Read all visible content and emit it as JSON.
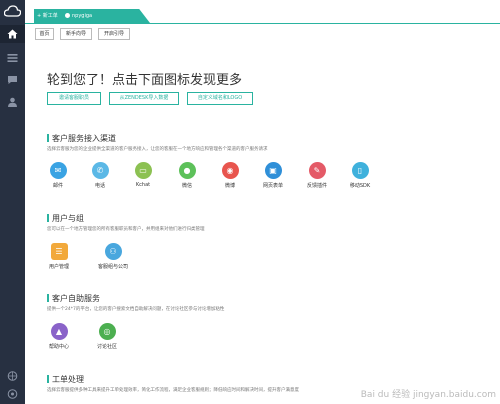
{
  "sidebar": {
    "icons": [
      "cloud-logo-icon",
      "home-icon",
      "list-icon",
      "chat-icon",
      "user-icon",
      "globe-icon",
      "help-icon"
    ]
  },
  "header": {
    "tabs": [
      {
        "label": "+ 新工单"
      },
      {
        "label": "npygiga"
      }
    ]
  },
  "breadcrumbs": [
    {
      "label": "首页"
    },
    {
      "label": "新手向导"
    },
    {
      "label": "开启引导"
    }
  ],
  "main": {
    "title": "轮到您了！点击下面图标发现更多",
    "actions": [
      {
        "label": "邀请客服职员"
      },
      {
        "label": "从ZENDESK导入数据"
      },
      {
        "label": "自定义域名和LOGO"
      }
    ]
  },
  "sections": [
    {
      "title": "客户服务接入渠道",
      "desc": "选择云客服为您的企业提供全渠道的客户服务接入，让您的客服在一个地方响应和管理各个渠道的客户服务请求",
      "items": [
        {
          "label": "邮件",
          "icon": "mail-icon",
          "color": "#3aa3e3",
          "glyph": "✉"
        },
        {
          "label": "电话",
          "icon": "phone-icon",
          "color": "#5bb8e6",
          "glyph": "✆"
        },
        {
          "label": "Kchat",
          "icon": "chat-bubble-icon",
          "color": "#8cc152",
          "glyph": "▭"
        },
        {
          "label": "微信",
          "icon": "wechat-icon",
          "color": "#5dc15a",
          "glyph": "●"
        },
        {
          "label": "微博",
          "icon": "weibo-icon",
          "color": "#e8554e",
          "glyph": "◉"
        },
        {
          "label": "网页表单",
          "icon": "monitor-icon",
          "color": "#2f8fd8",
          "glyph": "▣"
        },
        {
          "label": "反馈插件",
          "icon": "feedback-icon",
          "color": "#e45a67",
          "glyph": "✎"
        },
        {
          "label": "移动SDK",
          "icon": "mobile-icon",
          "color": "#3fb1dc",
          "glyph": "▯"
        }
      ]
    },
    {
      "title": "用户与组",
      "desc": "您可以在一个地方管理您的所有客服职员和客户，并用组来对他们进行归类管理",
      "items": [
        {
          "label": "用户管理",
          "icon": "user-manage-icon",
          "color": "#f2a93b",
          "glyph": "☰"
        },
        {
          "label": "客服组与公司",
          "icon": "group-icon",
          "color": "#49a7de",
          "glyph": "⚇"
        }
      ]
    },
    {
      "title": "客户自助服务",
      "desc": "提供一个24*7的平台，让您的客户搜索文档自助解决问题，在讨论社区参与讨论增加粘性",
      "items": [
        {
          "label": "帮助中心",
          "icon": "graduation-cap-icon",
          "color": "#8a63c9",
          "glyph": "▲"
        },
        {
          "label": "讨论社区",
          "icon": "community-icon",
          "color": "#4caf50",
          "glyph": "◎"
        }
      ]
    },
    {
      "title": "工单处理",
      "desc": "选择云客服提供多种工具来提升工单处理效率，简化工作流程，满足企业客服规则；降低响应时间和解决时间，提升客户满意度",
      "items": []
    }
  ],
  "watermark": "Bai du 经验 jingyan.baidu.com"
}
